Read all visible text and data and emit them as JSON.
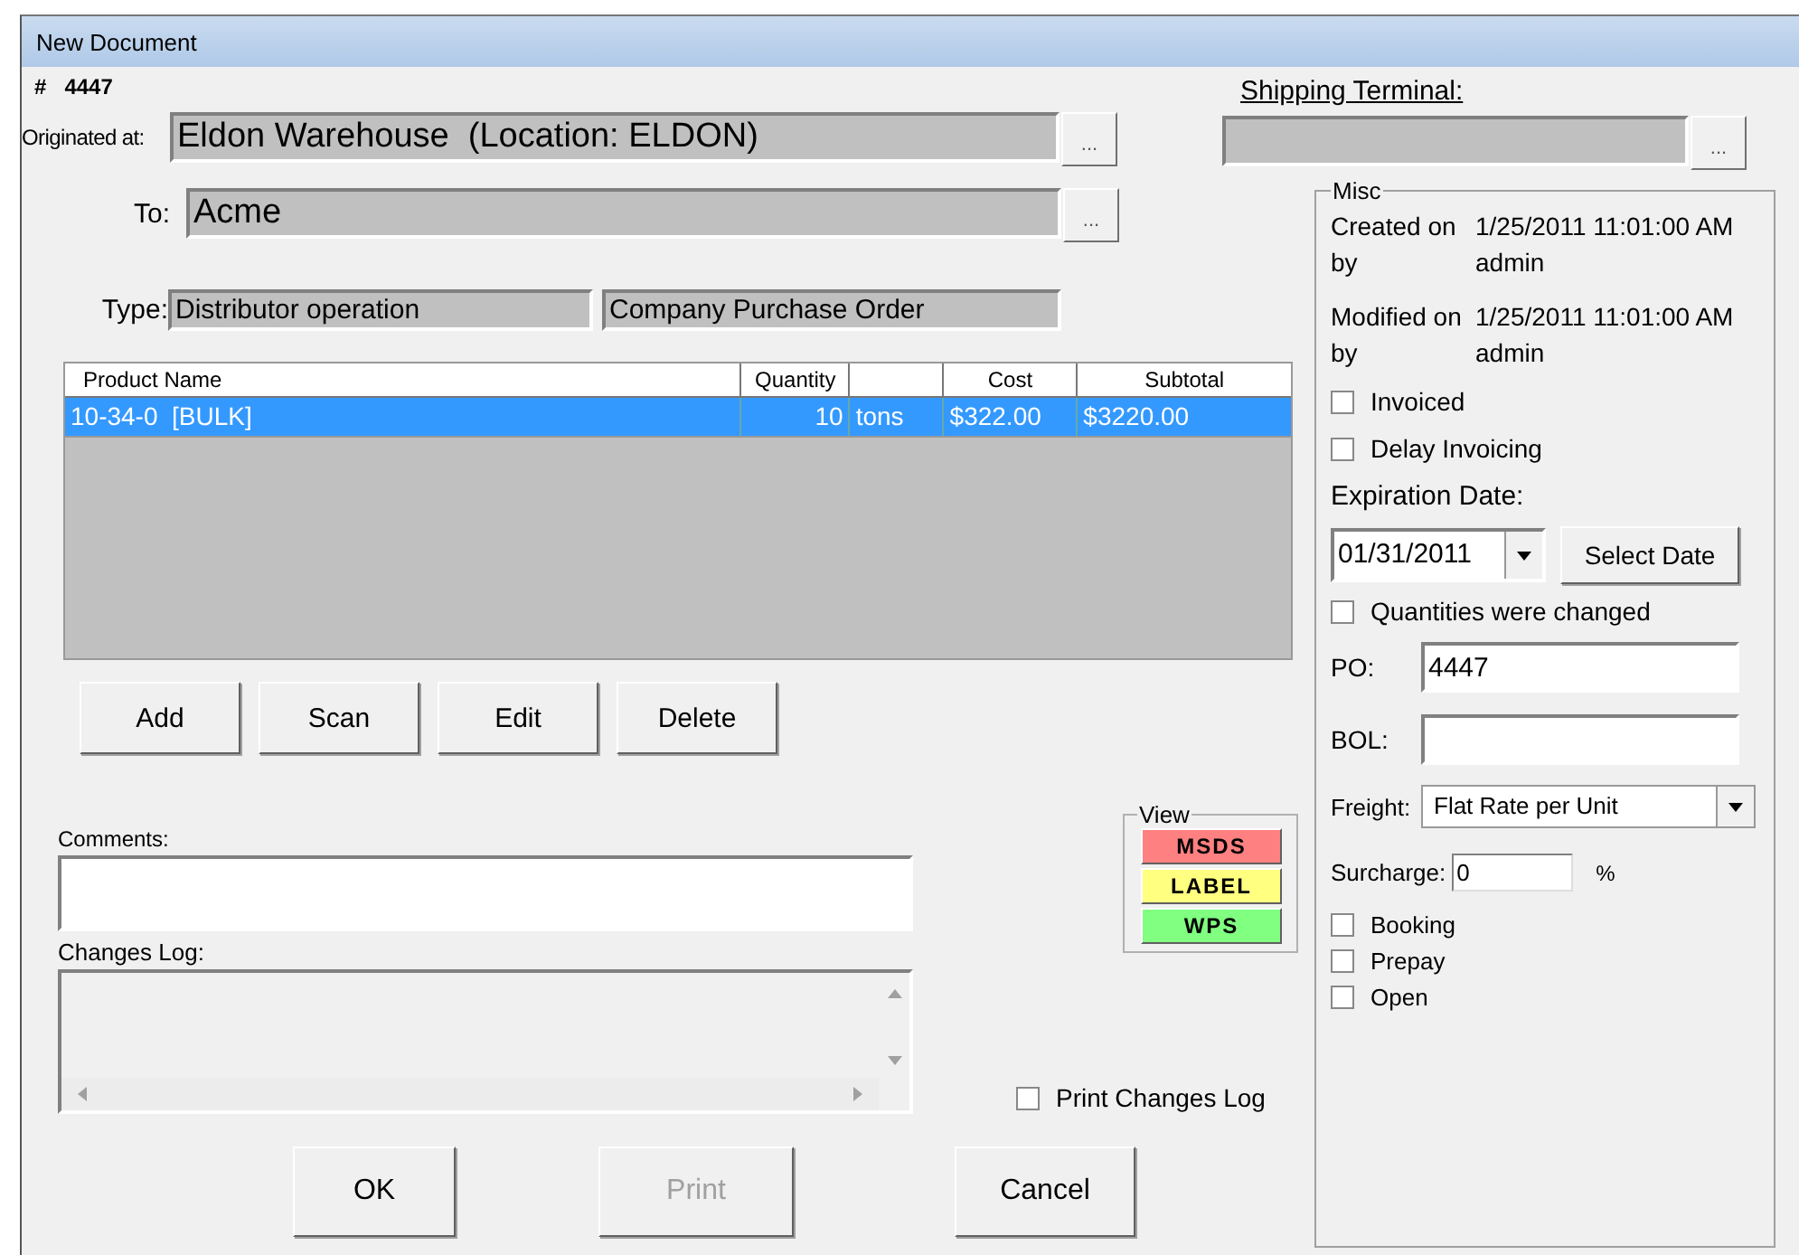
{
  "window": {
    "title": "New Document"
  },
  "doc_number": {
    "label": "#",
    "value": "4447"
  },
  "shipping_terminal": {
    "label": "Shipping Terminal:",
    "browse": "..."
  },
  "originated_at": {
    "label": "Originated at:",
    "value": "Eldon Warehouse  (Location: ELDON)",
    "browse": "..."
  },
  "to": {
    "label": "To:",
    "value": "Acme",
    "browse": "..."
  },
  "type": {
    "label": "Type:",
    "values": [
      "Distributor operation",
      "Company Purchase Order"
    ]
  },
  "products": {
    "columns": [
      {
        "label": "Product Name"
      },
      {
        "label": "Quantity"
      },
      {},
      {
        "label": "Cost"
      },
      {
        "label": "Subtotal"
      }
    ],
    "rows": [
      {
        "cells": [
          "10-34-0  [BULK]",
          "10",
          "tons",
          "$322.00",
          "$3220.00"
        ],
        "selected": true
      }
    ]
  },
  "item_buttons": [
    "Add",
    "Scan",
    "Edit",
    "Delete"
  ],
  "comments": {
    "label": "Comments:"
  },
  "changes_log": {
    "label": "Changes Log:"
  },
  "view": {
    "title": "View",
    "buttons": [
      {
        "label": "MSDS",
        "color": "#ff8080"
      },
      {
        "label": "LABEL",
        "color": "#ffff80"
      },
      {
        "label": "WPS",
        "color": "#80ff80"
      }
    ]
  },
  "print_changes_log": {
    "label": "Print Changes Log",
    "checked": false
  },
  "dialog_buttons": [
    {
      "label": "OK",
      "disabled": false
    },
    {
      "label": "Print",
      "disabled": true
    },
    {
      "label": "Cancel",
      "disabled": false
    }
  ],
  "misc": {
    "title": "Misc",
    "created": {
      "label": "Created on",
      "value": "1/25/2011 11:01:00 AM",
      "by_label": "by",
      "by": "admin"
    },
    "modified": {
      "label": "Modified on",
      "value": "1/25/2011 11:01:00 AM",
      "by_label": "by",
      "by": "admin"
    },
    "invoiced": {
      "label": "Invoiced",
      "checked": false
    },
    "delay_invoicing": {
      "label": "Delay Invoicing",
      "checked": false
    },
    "expiration_date": {
      "label": "Expiration Date:",
      "value": "01/31/2011",
      "button": "Select Date"
    },
    "quantities_changed": {
      "label": "Quantities were changed",
      "checked": false
    },
    "po": {
      "label": "PO:",
      "value": "4447"
    },
    "bol": {
      "label": "BOL:"
    },
    "freight": {
      "label": "Freight:",
      "value": "Flat Rate per Unit"
    },
    "surcharge": {
      "label": "Surcharge:",
      "value": "0",
      "unit": "%"
    },
    "flags": [
      {
        "label": "Booking",
        "checked": false
      },
      {
        "label": "Prepay",
        "checked": false
      },
      {
        "label": "Open",
        "checked": false
      }
    ]
  }
}
